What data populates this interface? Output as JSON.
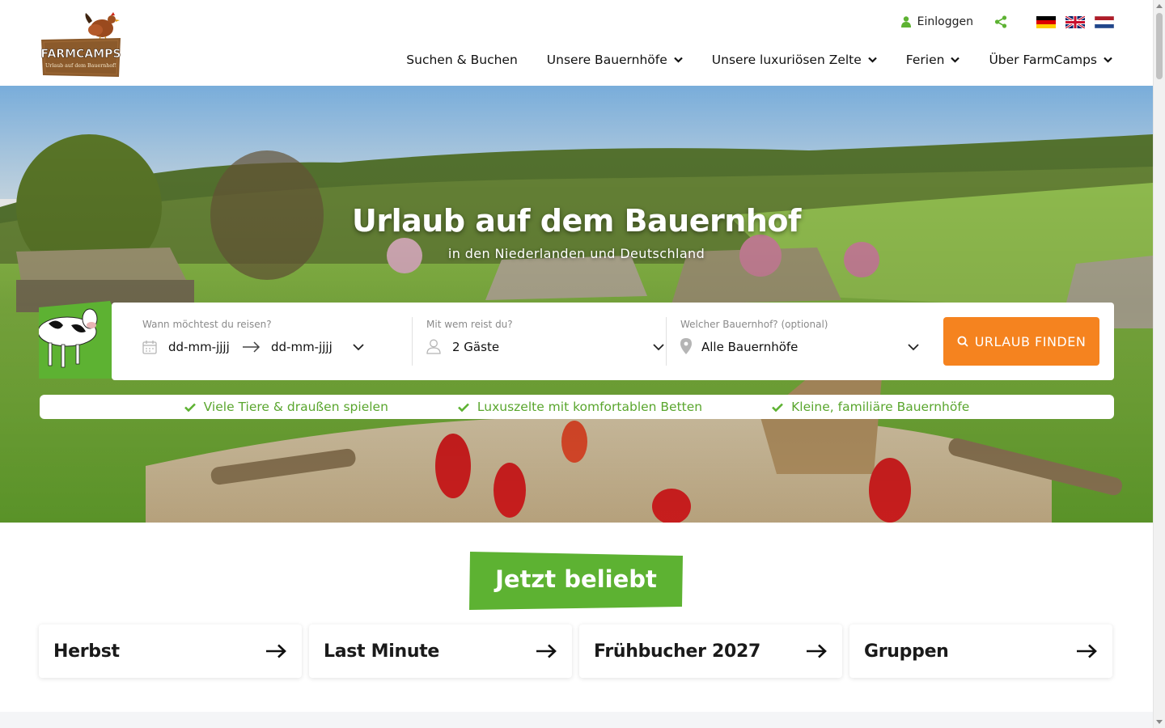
{
  "brand": {
    "name": "FARMCAMPS",
    "tagline": "Urlaub auf dem Bauernhof!"
  },
  "header": {
    "login_label": "Einloggen",
    "share_icon": "share-icon",
    "languages": [
      "de",
      "en",
      "nl"
    ],
    "nav": [
      {
        "label": "Suchen & Buchen",
        "dropdown": false
      },
      {
        "label": "Unsere Bauernhöfe",
        "dropdown": true
      },
      {
        "label": "Unsere luxuriösen Zelte",
        "dropdown": true
      },
      {
        "label": "Ferien",
        "dropdown": true
      },
      {
        "label": "Über FarmCamps",
        "dropdown": true
      }
    ]
  },
  "hero": {
    "title": "Urlaub auf dem Bauernhof",
    "subtitle": "in den Niederlanden und Deutschland"
  },
  "search": {
    "dates": {
      "label": "Wann möchtest du reisen?",
      "from_placeholder": "dd-mm-jjjj",
      "to_placeholder": "dd-mm-jjjj"
    },
    "guests": {
      "label": "Mit wem reist du?",
      "value": "2 Gäste"
    },
    "farm": {
      "label": "Welcher Bauernhof? (optional)",
      "value": "Alle Bauernhöfe"
    },
    "button_label": "URLAUB FINDEN"
  },
  "usps": [
    "Viele Tiere & draußen spielen",
    "Luxuszelte mit komfortablen Betten",
    "Kleine, familiäre Bauernhöfe"
  ],
  "popular": {
    "title": "Jetzt beliebt",
    "cards": [
      {
        "label": "Herbst"
      },
      {
        "label": "Last Minute"
      },
      {
        "label": "Frühbucher 2027"
      },
      {
        "label": "Gruppen"
      }
    ]
  },
  "colors": {
    "brand_green": "#5db232",
    "accent_orange": "#f5831f",
    "logo_brown": "#8b5a2b"
  }
}
